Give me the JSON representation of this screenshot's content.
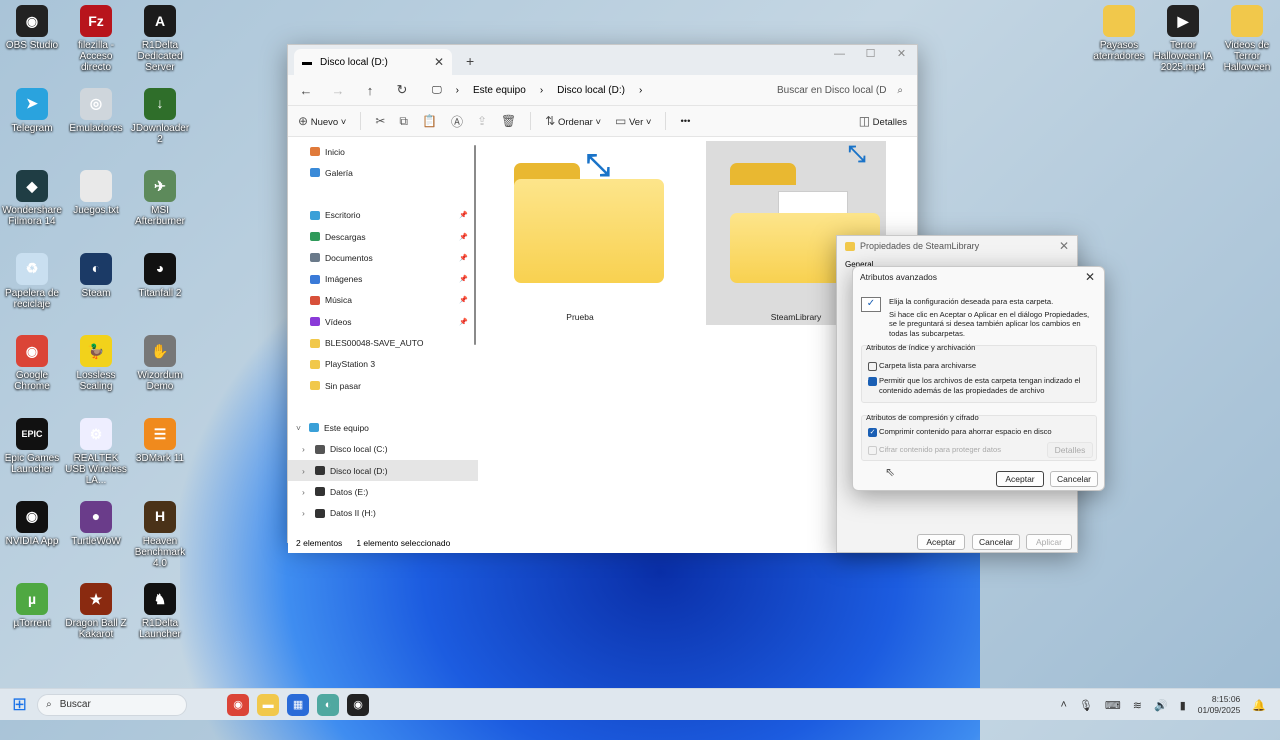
{
  "desktop": {
    "icons": [
      {
        "label": "OBS Studio",
        "color": "#222",
        "glyph": "◉"
      },
      {
        "label": "filezilla - Acceso directo",
        "color": "#b8141c",
        "glyph": "Fz"
      },
      {
        "label": "R1Delta Dedicated Server",
        "color": "#1b1b1b",
        "glyph": "A"
      },
      {
        "label": "Telegram",
        "color": "#2aa3de",
        "glyph": "➤"
      },
      {
        "label": "Emuladores",
        "color": "#cfd6dc",
        "glyph": "◎"
      },
      {
        "label": "JDownloader 2",
        "color": "#2f6e2a",
        "glyph": "↓"
      },
      {
        "label": "Wondershare Filmora 14",
        "color": "#1f3d44",
        "glyph": "◆"
      },
      {
        "label": "Juegos.txt",
        "color": "#e9e9e9",
        "glyph": ""
      },
      {
        "label": "MSI Afterburner",
        "color": "#5d8a5b",
        "glyph": "✈"
      },
      {
        "label": "Papelera de reciclaje",
        "color": "#c9dff0",
        "glyph": "♻"
      },
      {
        "label": "Steam",
        "color": "#1b3a66",
        "glyph": "◐"
      },
      {
        "label": "Titanfall 2",
        "color": "#111",
        "glyph": "◕"
      },
      {
        "label": "Google Chrome",
        "color": "#db4437",
        "glyph": "◉"
      },
      {
        "label": "Lossless Scaling",
        "color": "#f2d21b",
        "glyph": "🦆"
      },
      {
        "label": "Wizordum Demo",
        "color": "#777",
        "glyph": "✋"
      },
      {
        "label": "Epic Games Launcher",
        "color": "#111",
        "glyph": "EPIC"
      },
      {
        "label": "REALTEK USB Wireless LA...",
        "color": "#eef",
        "glyph": "⚙"
      },
      {
        "label": "3DMark 11",
        "color": "#f08a1d",
        "glyph": "☰"
      },
      {
        "label": "NVIDIA App",
        "color": "#111",
        "glyph": "◉"
      },
      {
        "label": "TurtleWoW",
        "color": "#6a3c8a",
        "glyph": "●"
      },
      {
        "label": "Heaven Benchmark 4.0",
        "color": "#4a3218",
        "glyph": "H"
      },
      {
        "label": "µTorrent",
        "color": "#4fa842",
        "glyph": "µ"
      },
      {
        "label": "Dragon Ball Z Kakarot",
        "color": "#8a2a10",
        "glyph": "★"
      },
      {
        "label": "R1Delta Launcher",
        "color": "#111",
        "glyph": "♞"
      }
    ],
    "right_icons": [
      {
        "label": "Payasos aterradores",
        "color": "#f1c84b",
        "glyph": ""
      },
      {
        "label": "Terror Halloween IA 2025.mp4",
        "color": "#222",
        "glyph": "▶"
      },
      {
        "label": "Videos de Terror Halloween",
        "color": "#f1c84b",
        "glyph": ""
      }
    ]
  },
  "explorer": {
    "tab": "Disco local (D:)",
    "breadcrumb": [
      "Este equipo",
      "Disco local (D:)"
    ],
    "search_placeholder": "Buscar en Disco local (D",
    "toolbar": {
      "new": "Nuevo",
      "sort": "Ordenar",
      "view": "Ver",
      "more": "•••",
      "details": "Detalles"
    },
    "sidebar": [
      {
        "label": "Inicio",
        "color": "#e07a3a"
      },
      {
        "label": "Galería",
        "color": "#3a8ad8"
      },
      {
        "label": "Escritorio",
        "color": "#3aa0d8",
        "pinned": true
      },
      {
        "label": "Descargas",
        "color": "#2f9a5a",
        "pinned": true
      },
      {
        "label": "Documentos",
        "color": "#6a7a8a",
        "pinned": true
      },
      {
        "label": "Imágenes",
        "color": "#3a7ad8",
        "pinned": true
      },
      {
        "label": "Música",
        "color": "#d8503a",
        "pinned": true
      },
      {
        "label": "Vídeos",
        "color": "#8a3ad8",
        "pinned": true
      },
      {
        "label": "BLES00048-SAVE_AUTO",
        "color": "#f1c84b"
      },
      {
        "label": "PlayStation 3",
        "color": "#f1c84b"
      },
      {
        "label": "Sin pasar",
        "color": "#f1c84b"
      },
      {
        "label": "Este equipo",
        "color": "#3aa0d8"
      },
      {
        "label": "Disco local (C:)",
        "color": "#555"
      },
      {
        "label": "Disco local (D:)",
        "color": "#333"
      },
      {
        "label": "Datos (E:)",
        "color": "#333"
      },
      {
        "label": "Datos II (H:)",
        "color": "#333"
      }
    ],
    "items": [
      "Prueba",
      "SteamLibrary"
    ],
    "status": {
      "count": "2 elementos",
      "selected": "1 elemento seleccionado"
    }
  },
  "properties": {
    "title": "Propiedades de SteamLibrary",
    "tab": "General",
    "ok": "Aceptar",
    "cancel": "Cancelar",
    "apply": "Aplicar"
  },
  "advanced": {
    "title": "Atributos avanzados",
    "intro1": "Elija la configuración deseada para esta carpeta.",
    "intro2": "Si hace clic en Aceptar o Aplicar en el diálogo Propiedades, se le preguntará si desea también aplicar los cambios en todas las subcarpetas.",
    "group1": "Atributos de índice y archivación",
    "archive": "Carpeta lista para archivarse",
    "archive_checked": false,
    "index": "Permitir que los archivos de esta carpeta tengan indizado el contenido además de las propiedades de archivo",
    "index_checked": true,
    "group2": "Atributos de compresión y cifrado",
    "compress": "Comprimir contenido para ahorrar espacio en disco",
    "compress_checked": true,
    "encrypt": "Cifrar contenido para proteger datos",
    "encrypt_checked": false,
    "details": "Detalles",
    "ok": "Aceptar",
    "cancel": "Cancelar"
  },
  "taskbar": {
    "search": "Buscar",
    "time": "8:15:06",
    "date": "01/09/2025"
  }
}
